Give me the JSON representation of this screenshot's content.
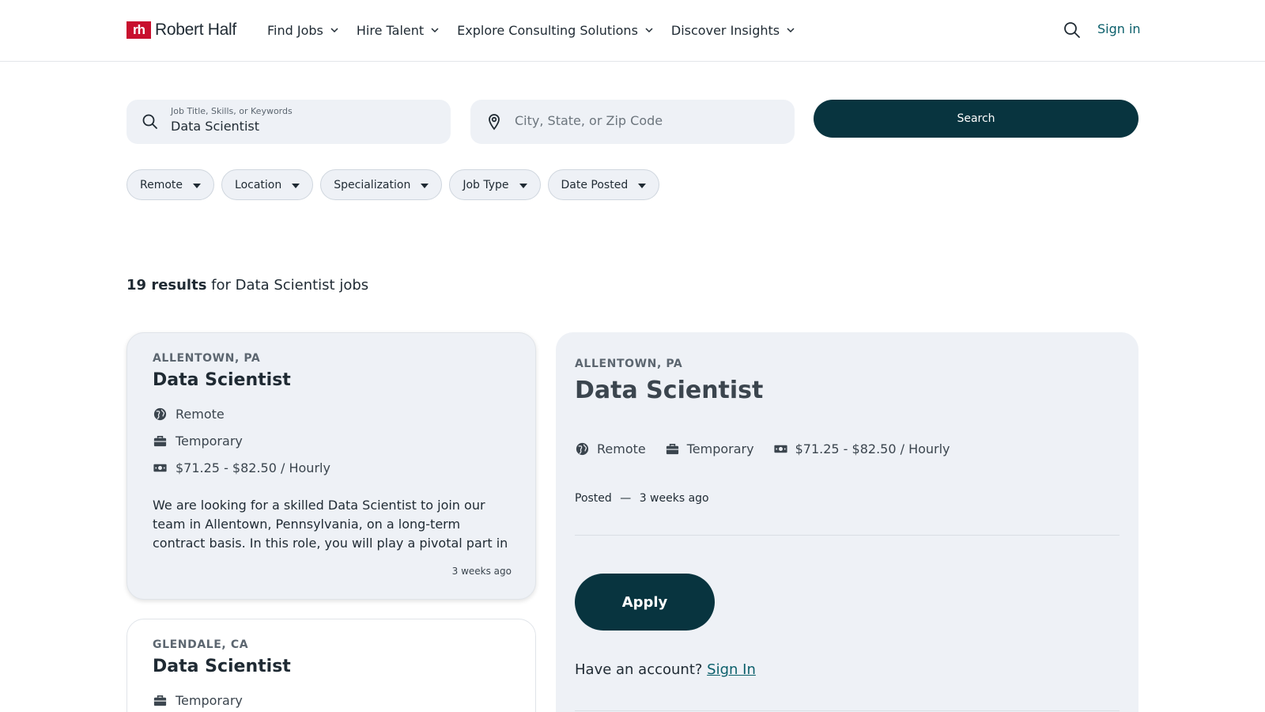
{
  "header": {
    "logo_mark": "rh",
    "logo_text": "Robert Half",
    "nav": [
      {
        "label": "Find Jobs"
      },
      {
        "label": "Hire Talent"
      },
      {
        "label": "Explore Consulting Solutions"
      },
      {
        "label": "Discover Insights"
      }
    ],
    "sign_in": "Sign in"
  },
  "search": {
    "keyword_label": "Job Title, Skills, or Keywords",
    "keyword_value": "Data Scientist",
    "location_placeholder": "City, State, or Zip Code",
    "button": "Search"
  },
  "filters": [
    "Remote",
    "Location",
    "Specialization",
    "Job Type",
    "Date Posted"
  ],
  "results": {
    "count": "19 results",
    "suffix": " for Data Scientist jobs"
  },
  "jobs": [
    {
      "location": "ALLENTOWN, PA",
      "title": "Data Scientist",
      "remote": "Remote",
      "type": "Temporary",
      "pay": "$71.25 - $82.50 / Hourly",
      "description": "We are looking for a skilled Data Scientist to join our team in Allentown, Pennsylvania, on a long-term contract basis. In this role, you will play a pivotal part in leveraging analytics…",
      "posted": "3 weeks ago"
    },
    {
      "location": "GLENDALE, CA",
      "title": "Data Scientist",
      "type": "Temporary"
    }
  ],
  "detail": {
    "location": "ALLENTOWN, PA",
    "title": "Data Scientist",
    "remote": "Remote",
    "type": "Temporary",
    "pay": "$71.25 - $82.50 / Hourly",
    "posted_label": "Posted",
    "posted_sep": "—",
    "posted_value": "3 weeks ago",
    "apply": "Apply",
    "account_prompt": "Have an account?",
    "sign_in": "Sign In"
  },
  "colors": {
    "brand_red": "#c8102e",
    "primary_dark": "#08343f",
    "link": "#0b5f6b",
    "surface": "#eef1f6"
  }
}
